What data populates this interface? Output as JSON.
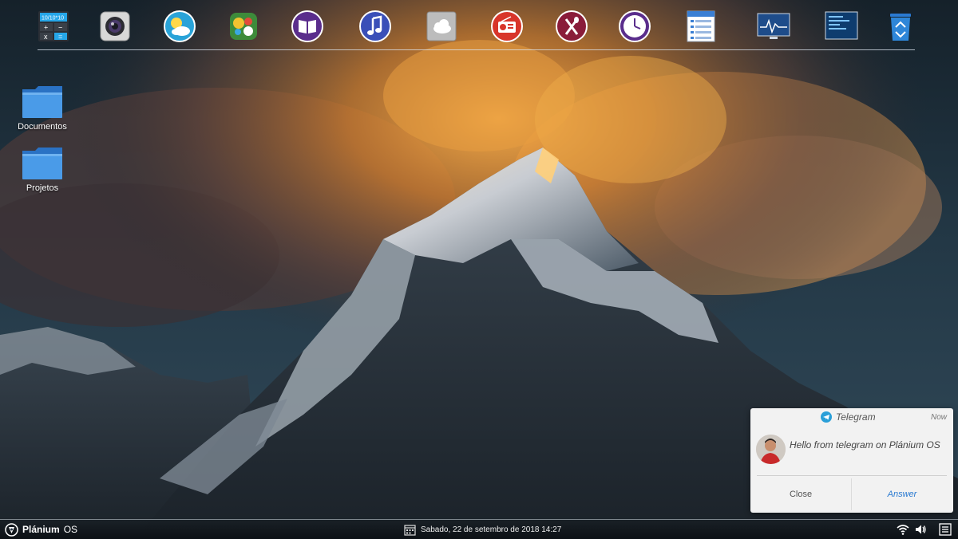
{
  "dock": {
    "items": [
      {
        "icon": "calculator-icon",
        "display": "10/10*10"
      },
      {
        "icon": "webcam-icon"
      },
      {
        "icon": "weather-icon"
      },
      {
        "icon": "games-icon"
      },
      {
        "icon": "ebook-reader-icon"
      },
      {
        "icon": "music-player-icon"
      },
      {
        "icon": "cloud-storage-icon"
      },
      {
        "icon": "radio-icon"
      },
      {
        "icon": "recipes-icon"
      },
      {
        "icon": "clock-icon"
      },
      {
        "icon": "task-list-icon"
      },
      {
        "icon": "system-monitor-icon"
      },
      {
        "icon": "terminal-icon"
      },
      {
        "icon": "trash-icon"
      }
    ]
  },
  "desktop": {
    "icons": [
      {
        "label": "Documentos",
        "icon": "folder-icon"
      },
      {
        "label": "Projetos",
        "icon": "folder-icon"
      }
    ]
  },
  "notification": {
    "app_name": "Telegram",
    "time": "Now",
    "message": "Hello from telegram on Plánium OS",
    "close_label": "Close",
    "answer_label": "Answer",
    "accent_color": "#2a7ad1"
  },
  "taskbar": {
    "brand_name": "Plánium",
    "brand_suffix": "OS",
    "datetime": "Sabado, 22 de setembro de 2018 14:27",
    "tray_icons": [
      "wifi-icon",
      "volume-icon",
      "menu-icon"
    ]
  }
}
